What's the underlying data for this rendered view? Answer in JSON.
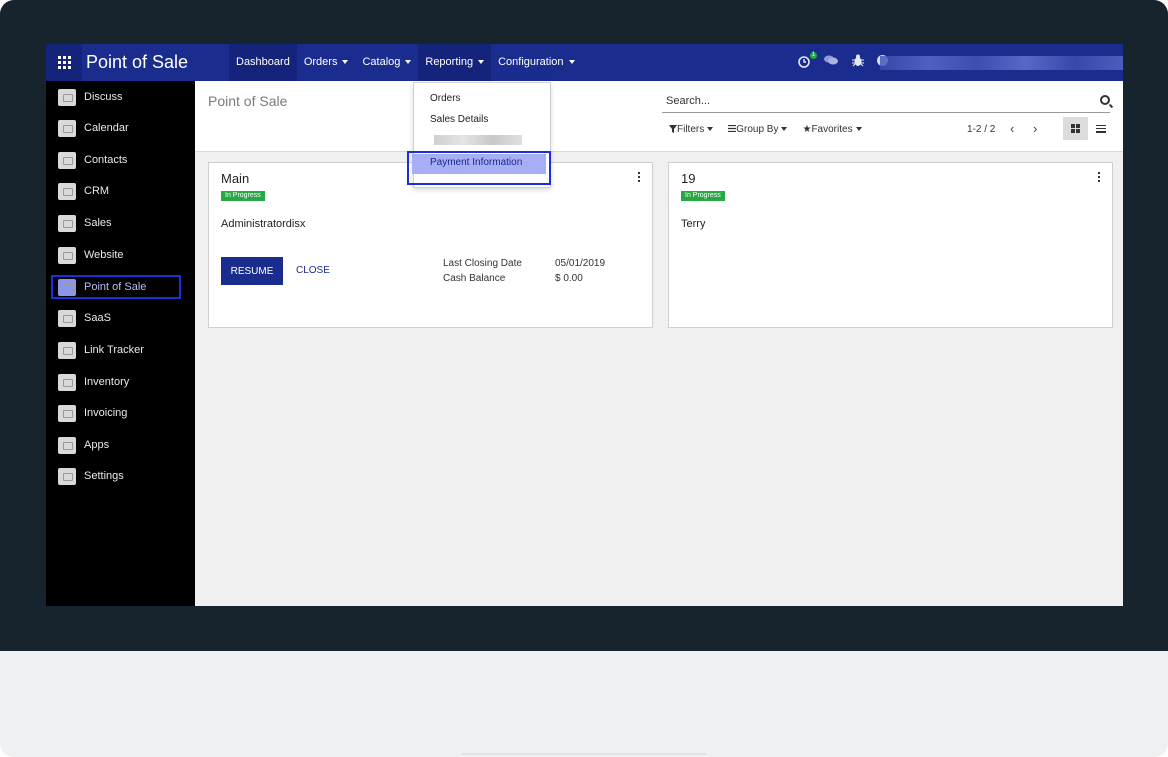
{
  "app": {
    "brand": "Point of Sale",
    "menu": [
      {
        "label": "Dashboard",
        "caret": false,
        "active": true
      },
      {
        "label": "Orders",
        "caret": true,
        "active": false
      },
      {
        "label": "Catalog",
        "caret": true,
        "active": false
      },
      {
        "label": "Reporting",
        "caret": true,
        "active": true
      },
      {
        "label": "Configuration",
        "caret": true,
        "active": false
      }
    ],
    "activity_badge": "1",
    "accent": "#1a2d8f"
  },
  "sidebar": {
    "items": [
      {
        "label": "Discuss"
      },
      {
        "label": "Calendar"
      },
      {
        "label": "Contacts"
      },
      {
        "label": "CRM"
      },
      {
        "label": "Sales"
      },
      {
        "label": "Website"
      },
      {
        "label": "Point of Sale",
        "active": true
      },
      {
        "label": "SaaS"
      },
      {
        "label": "Link Tracker"
      },
      {
        "label": "Inventory"
      },
      {
        "label": "Invoicing"
      },
      {
        "label": "Apps"
      },
      {
        "label": "Settings"
      }
    ]
  },
  "control_panel": {
    "title": "Point of Sale",
    "search_placeholder": "Search...",
    "filters_label": "Filters",
    "groupby_label": "Group By",
    "favorites_label": "Favorites",
    "pager": "1-2 / 2",
    "prev_icon": "‹",
    "next_icon": "›"
  },
  "reporting_dropdown": {
    "items": [
      "Orders",
      "Sales Details",
      "Payment Information"
    ],
    "highlighted": "Payment Information"
  },
  "cards": [
    {
      "title": "Main",
      "status": "In Progress",
      "user": "Administratordisx",
      "resume_label": "RESUME",
      "close_label": "CLOSE",
      "last_closing_label": "Last Closing Date",
      "last_closing_value": "05/01/2019",
      "cash_balance_label": "Cash Balance",
      "cash_balance_value": "$ 0.00"
    },
    {
      "title": "19",
      "status": "In Progress",
      "user": "Terry"
    }
  ]
}
